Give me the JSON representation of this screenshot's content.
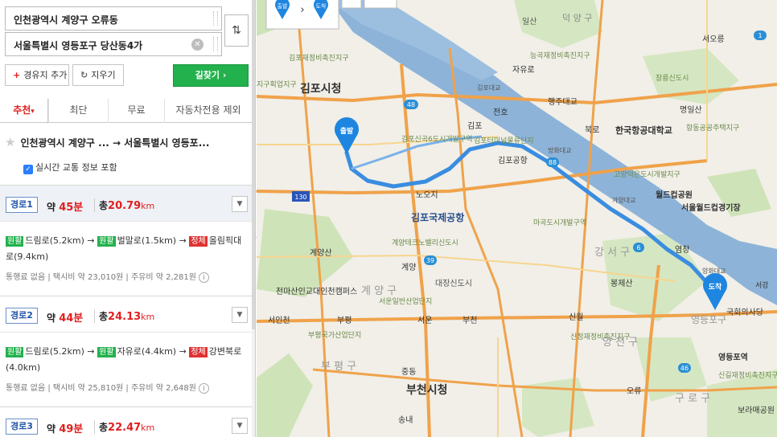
{
  "search": {
    "origin": "인천광역시 계양구 오류동",
    "destination": "서울특별시 영등포구 당산동4가",
    "swap_icon": "⇅",
    "clear_icon": "✕",
    "add_waypoint_label": "경유지 추가",
    "clear_label": "지우기",
    "find_route_label": "길찾기 ›"
  },
  "tabs": [
    {
      "label": "추천",
      "active": true
    },
    {
      "label": "최단",
      "active": false
    },
    {
      "label": "무료",
      "active": false
    },
    {
      "label": "자동차전용 제외",
      "active": false
    }
  ],
  "summary": {
    "text": "인천광역시 계양구 ... → 서울특별시 영등포...",
    "traffic_label": "실시간 교통 정보 포함"
  },
  "routes": [
    {
      "label": "경로1",
      "time_prefix": "약 ",
      "time": "45분",
      "dist_prefix": "총",
      "dist": "20.79",
      "dist_unit": "km",
      "segments": [
        {
          "tag": "원활",
          "tag_color": "#22b14c",
          "text": "드림로(5.2km)"
        },
        {
          "tag": "원활",
          "tag_color": "#22b14c",
          "text": "벌말로(1.5km)"
        },
        {
          "tag": "정체",
          "tag_color": "#e03131",
          "text": "올림픽대로(9.4km)"
        }
      ],
      "meta": "통행료 없음 | 택시비 약 23,010원 | 주유비 약 2,281원"
    },
    {
      "label": "경로2",
      "time_prefix": "약 ",
      "time": "44분",
      "dist_prefix": "총",
      "dist": "24.13",
      "dist_unit": "km",
      "segments": [
        {
          "tag": "원활",
          "tag_color": "#22b14c",
          "text": "드림로(5.2km)"
        },
        {
          "tag": "원활",
          "tag_color": "#22b14c",
          "text": "자유로(4.4km)"
        },
        {
          "tag": "정체",
          "tag_color": "#e03131",
          "text": "강변북로(4.0km)"
        }
      ],
      "meta": "통행료 없음 | 택시비 약 25,810원 | 주유비 약 2,648원"
    },
    {
      "label": "경로3",
      "time_prefix": "약 ",
      "time": "49분",
      "dist_prefix": "총",
      "dist": "22.47",
      "dist_unit": "km"
    }
  ],
  "map": {
    "top_legend": {
      "start": "출발",
      "end": "도착"
    },
    "start_pin": "출발",
    "end_pin": "도착",
    "labels": {
      "gimpo_city_hall": "김포시청",
      "gimpo_airport": "김포국제공항",
      "bucheon_city_hall": "부천시청",
      "gimpo_rebuild": "김포재정비촉진지구",
      "jigu_upjigu": "지구획업지구",
      "ilsan": "일산",
      "deokyang": "덕 양 구",
      "neunggok": "능곡재정비촉진지구",
      "jayuro": "자유로",
      "gimpo_bridge": "김포대교",
      "haengju_bridge": "행주대교",
      "jeonho": "전호",
      "gimpo_ic": "김포",
      "bukro": "북로",
      "korea_aviation": "한국항공대학교",
      "myeongsan": "명일산",
      "hangdong": "항동공공주택지구",
      "gimpo_sinkok": "김포신곡6도시개발구역",
      "gimpo_terminal": "김포터미널물류단지",
      "gimpo_airport_jc": "김포공항",
      "banghwa": "방화대교",
      "nodeul": "노오지",
      "mago": "마곡도시개발구역",
      "seoul_worldcup": "서울월드컵경기장",
      "gayang": "가양대교",
      "gangseo": "강 서 구",
      "yeomchang": "염창",
      "gyeyangsan": "계양산",
      "gyeyang_techno": "계양테크노밸리신도시",
      "gyeyang_ic": "계양",
      "daejang": "대장신도시",
      "bongjesan": "봉제산",
      "incheon_univ": "천마산인교대인천캠퍼스",
      "gyeyang_gu": "계 양 구",
      "seoun": "서운일반산업단지",
      "seoincheon": "서인천",
      "bupyeong_ic": "부평",
      "seoun_ic": "서운",
      "bucheon_ic": "부천",
      "sinwol": "신월",
      "sinjeong": "신정재정비촉진지구",
      "yangcheon": "양 천 구",
      "guro_gu": "구 로 구",
      "bupyeong": "부평국가산업단지",
      "bupyeong_gu": "부 평 구",
      "jungdong": "중동",
      "songnae": "송내",
      "oryu": "오류",
      "yeongdeungpo_gu": "영등포구",
      "yeongdeungpo_stn": "영등포역",
      "sinkil": "신길재정비촉진지구",
      "boramae": "보라매공원",
      "national_assembly": "국회의사당",
      "seoreung": "서오릉",
      "gangseo_office": "강서구",
      "gangmang": "창릉신도시",
      "goyang": "고양덕은도시개발지구",
      "worldcup_park": "월드컵공원",
      "yanghwa": "양화대교",
      "seogang": "서강"
    },
    "road_badges": {
      "r48": "48",
      "r130": "130",
      "r39": "39",
      "r88": "88",
      "r6": "6",
      "r46": "46",
      "r1": "1"
    }
  }
}
